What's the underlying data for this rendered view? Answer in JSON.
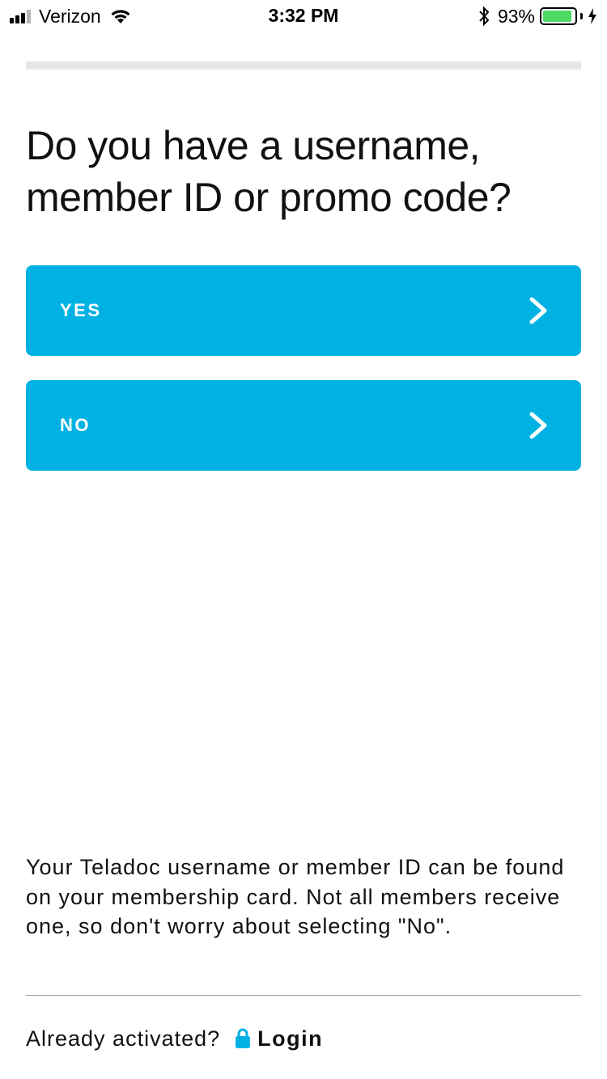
{
  "status_bar": {
    "carrier": "Verizon",
    "time": "3:32 PM",
    "battery_percent": "93%",
    "battery_level": 0.93,
    "icons": [
      "signal-icon",
      "wifi-icon",
      "bluetooth-icon",
      "battery-icon",
      "charging-icon"
    ]
  },
  "progress": {
    "fraction": 0.0,
    "color": "#e6e6e6",
    "fill_color": "#00b2e3"
  },
  "question": "Do you have a username, member ID or promo code?",
  "choices": [
    {
      "label": "YES",
      "icon": "chevron-right-icon"
    },
    {
      "label": "NO",
      "icon": "chevron-right-icon"
    }
  ],
  "accent_color": "#00b2e3",
  "help_text": "Your Teladoc username or member ID can be found on your membership card. Not all members receive one, so don't worry about selecting \"No\".",
  "login": {
    "prompt": "Already activated?",
    "icon": "lock-icon",
    "label": "Login"
  }
}
